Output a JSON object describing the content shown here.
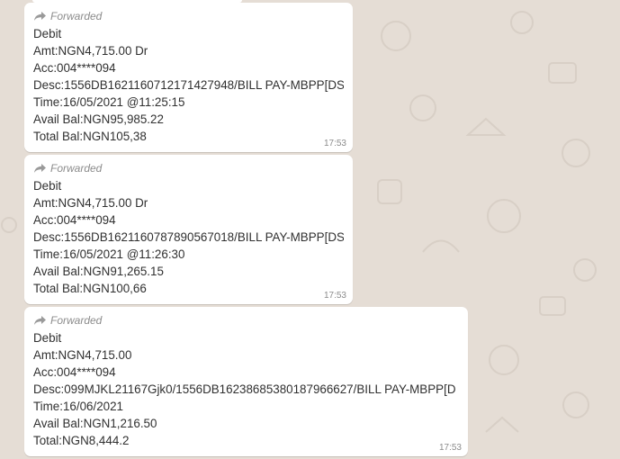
{
  "chat": {
    "messages": [
      {
        "forwarded_label": "Forwarded",
        "lines": [
          "Debit",
          "Amt:NGN4,715.00 Dr",
          "Acc:004****094",
          "Desc:1556DB16211607121714279​48/BILL PAY-MBPP[DS",
          "Time:16/05/2021 @11:25:15",
          "Avail Bal:NGN95,985.22",
          "Total Bal:NGN105,38"
        ],
        "time": "17:53"
      },
      {
        "forwarded_label": "Forwarded",
        "lines": [
          "Debit",
          "Amt:NGN4,715.00 Dr",
          "Acc:004****094",
          "Desc:1556DB16211607878905670​18/BILL PAY-MBPP[DS",
          "Time:16/05/2021 @11:26:30",
          "Avail Bal:NGN91,265.15",
          "Total Bal:NGN100,66"
        ],
        "time": "17:53"
      },
      {
        "forwarded_label": "Forwarded",
        "lines": [
          "Debit",
          "Amt:NGN4,715.00",
          "Acc:004****094",
          "Desc:099MJKL21167Gjk0/1556DB16238685380187966627/BILL PAY-MBPP[D",
          "Time:16/06/2021",
          "Avail Bal:NGN1,216.50",
          "Total:NGN8,444.2"
        ],
        "time": "17:53"
      }
    ]
  },
  "colors": {
    "background": "#e5ddd5",
    "bubble": "#ffffff",
    "meta_text": "#8c8c8c",
    "body_text": "#303030"
  },
  "icons": {
    "forward": "forward-arrow-icon"
  }
}
